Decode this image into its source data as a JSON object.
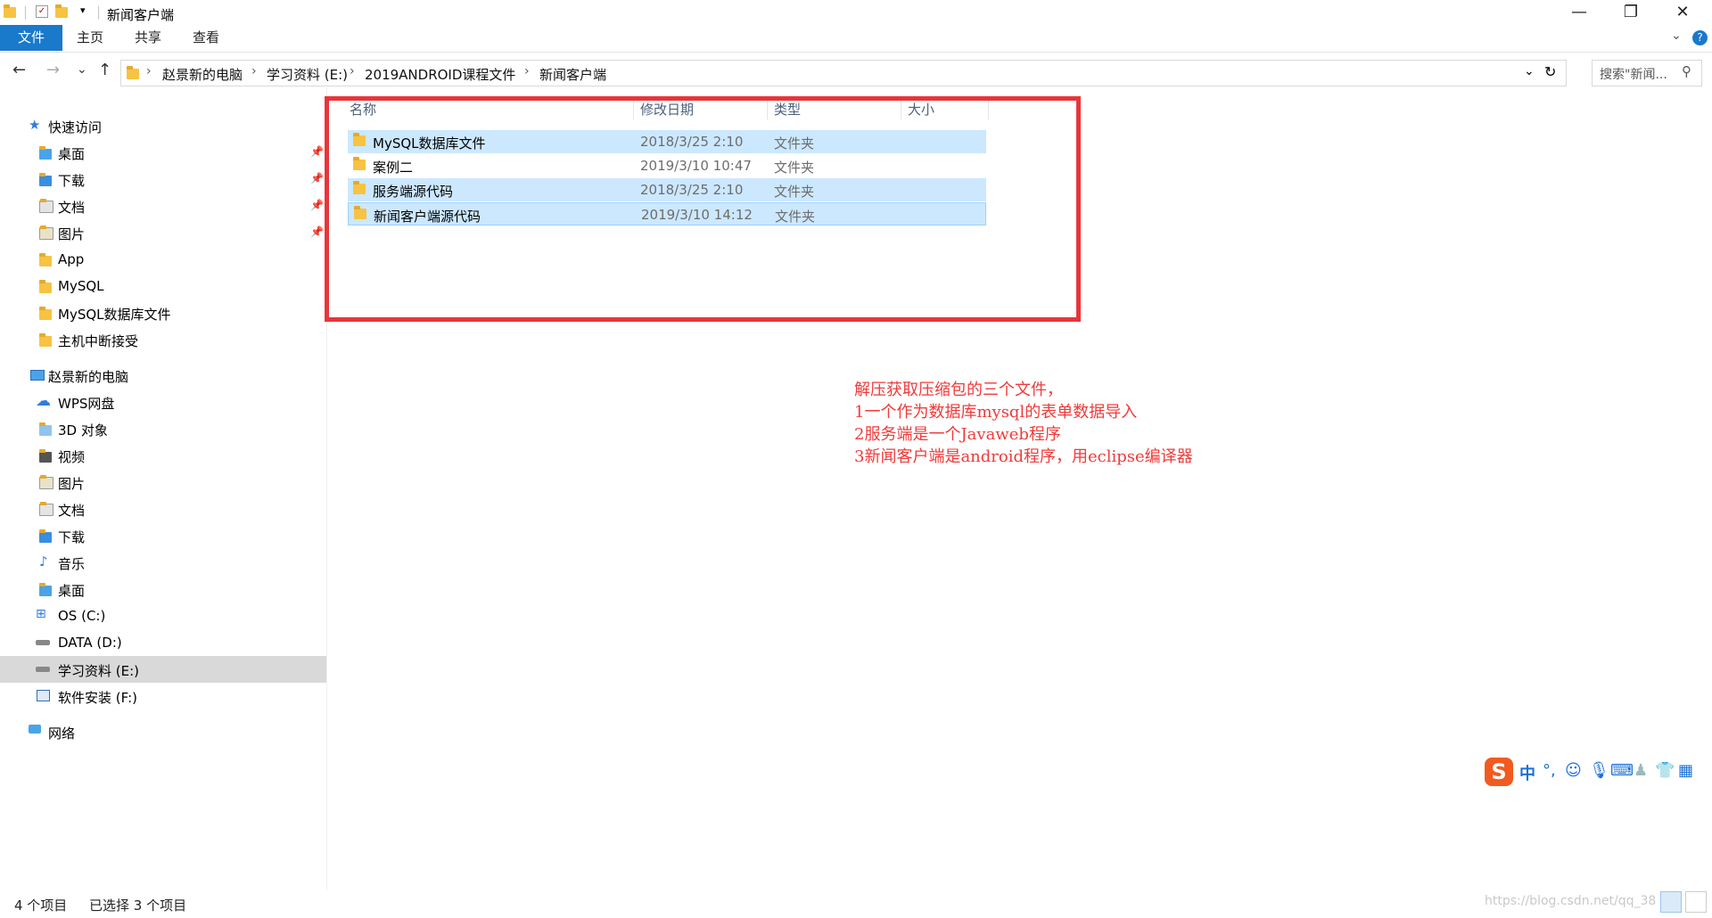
{
  "window": {
    "title": "新闻客户端",
    "controls": {
      "minimize": "—",
      "restore": "❐",
      "close": "✕"
    }
  },
  "ribbon": {
    "tabs": [
      "文件",
      "主页",
      "共享",
      "查看"
    ],
    "collapse_icon": "chevron-down-icon",
    "help": "?"
  },
  "nav": {
    "back": "←",
    "forward": "→",
    "recent": "⌄",
    "up": "↑",
    "breadcrumb": [
      "赵景新的电脑",
      "学习资料 (E:)",
      "2019ANDROID课程文件",
      "新闻客户端"
    ],
    "search_placeholder": "搜索\"新闻..."
  },
  "navpane": {
    "quick_access": {
      "label": "快速访问",
      "items": [
        "桌面",
        "下载",
        "文档",
        "图片",
        "App",
        "MySQL",
        "MySQL数据库文件",
        "主机中断接受"
      ]
    },
    "this_pc": {
      "label": "赵景新的电脑",
      "items": [
        "WPS网盘",
        "3D 对象",
        "视频",
        "图片",
        "文档",
        "下载",
        "音乐",
        "桌面",
        "OS (C:)",
        "DATA (D:)",
        "学习资料 (E:)",
        "软件安装 (F:)"
      ]
    },
    "network": {
      "label": "网络"
    }
  },
  "columns": [
    "名称",
    "修改日期",
    "类型",
    "大小"
  ],
  "files": [
    {
      "name": "MySQL数据库文件",
      "date": "2018/3/25 2:10",
      "type": "文件夹",
      "size": "",
      "selected": true
    },
    {
      "name": "案例二",
      "date": "2019/3/10 10:47",
      "type": "文件夹",
      "size": "",
      "selected": false
    },
    {
      "name": "服务端源代码",
      "date": "2018/3/25 2:10",
      "type": "文件夹",
      "size": "",
      "selected": true
    },
    {
      "name": "新闻客户端源代码",
      "date": "2019/3/10 14:12",
      "type": "文件夹",
      "size": "",
      "selected": true
    }
  ],
  "annotation": [
    "解压获取压缩包的三个文件，",
    "1一个作为数据库mysql的表单数据导入",
    "2服务端是一个Javaweb程序",
    "3新闻客户端是android程序，用eclipse编译器"
  ],
  "ime": {
    "logo": "S",
    "mode": "中"
  },
  "status": {
    "count": "4 个项目",
    "selection": "已选择 3 个项目"
  },
  "watermark": "https://blog.csdn.net/qq_38",
  "colors": {
    "accent": "#1979ca",
    "selection": "#cce8ff",
    "annotation": "#f03a3a",
    "highlight_box": "#e8353b"
  }
}
